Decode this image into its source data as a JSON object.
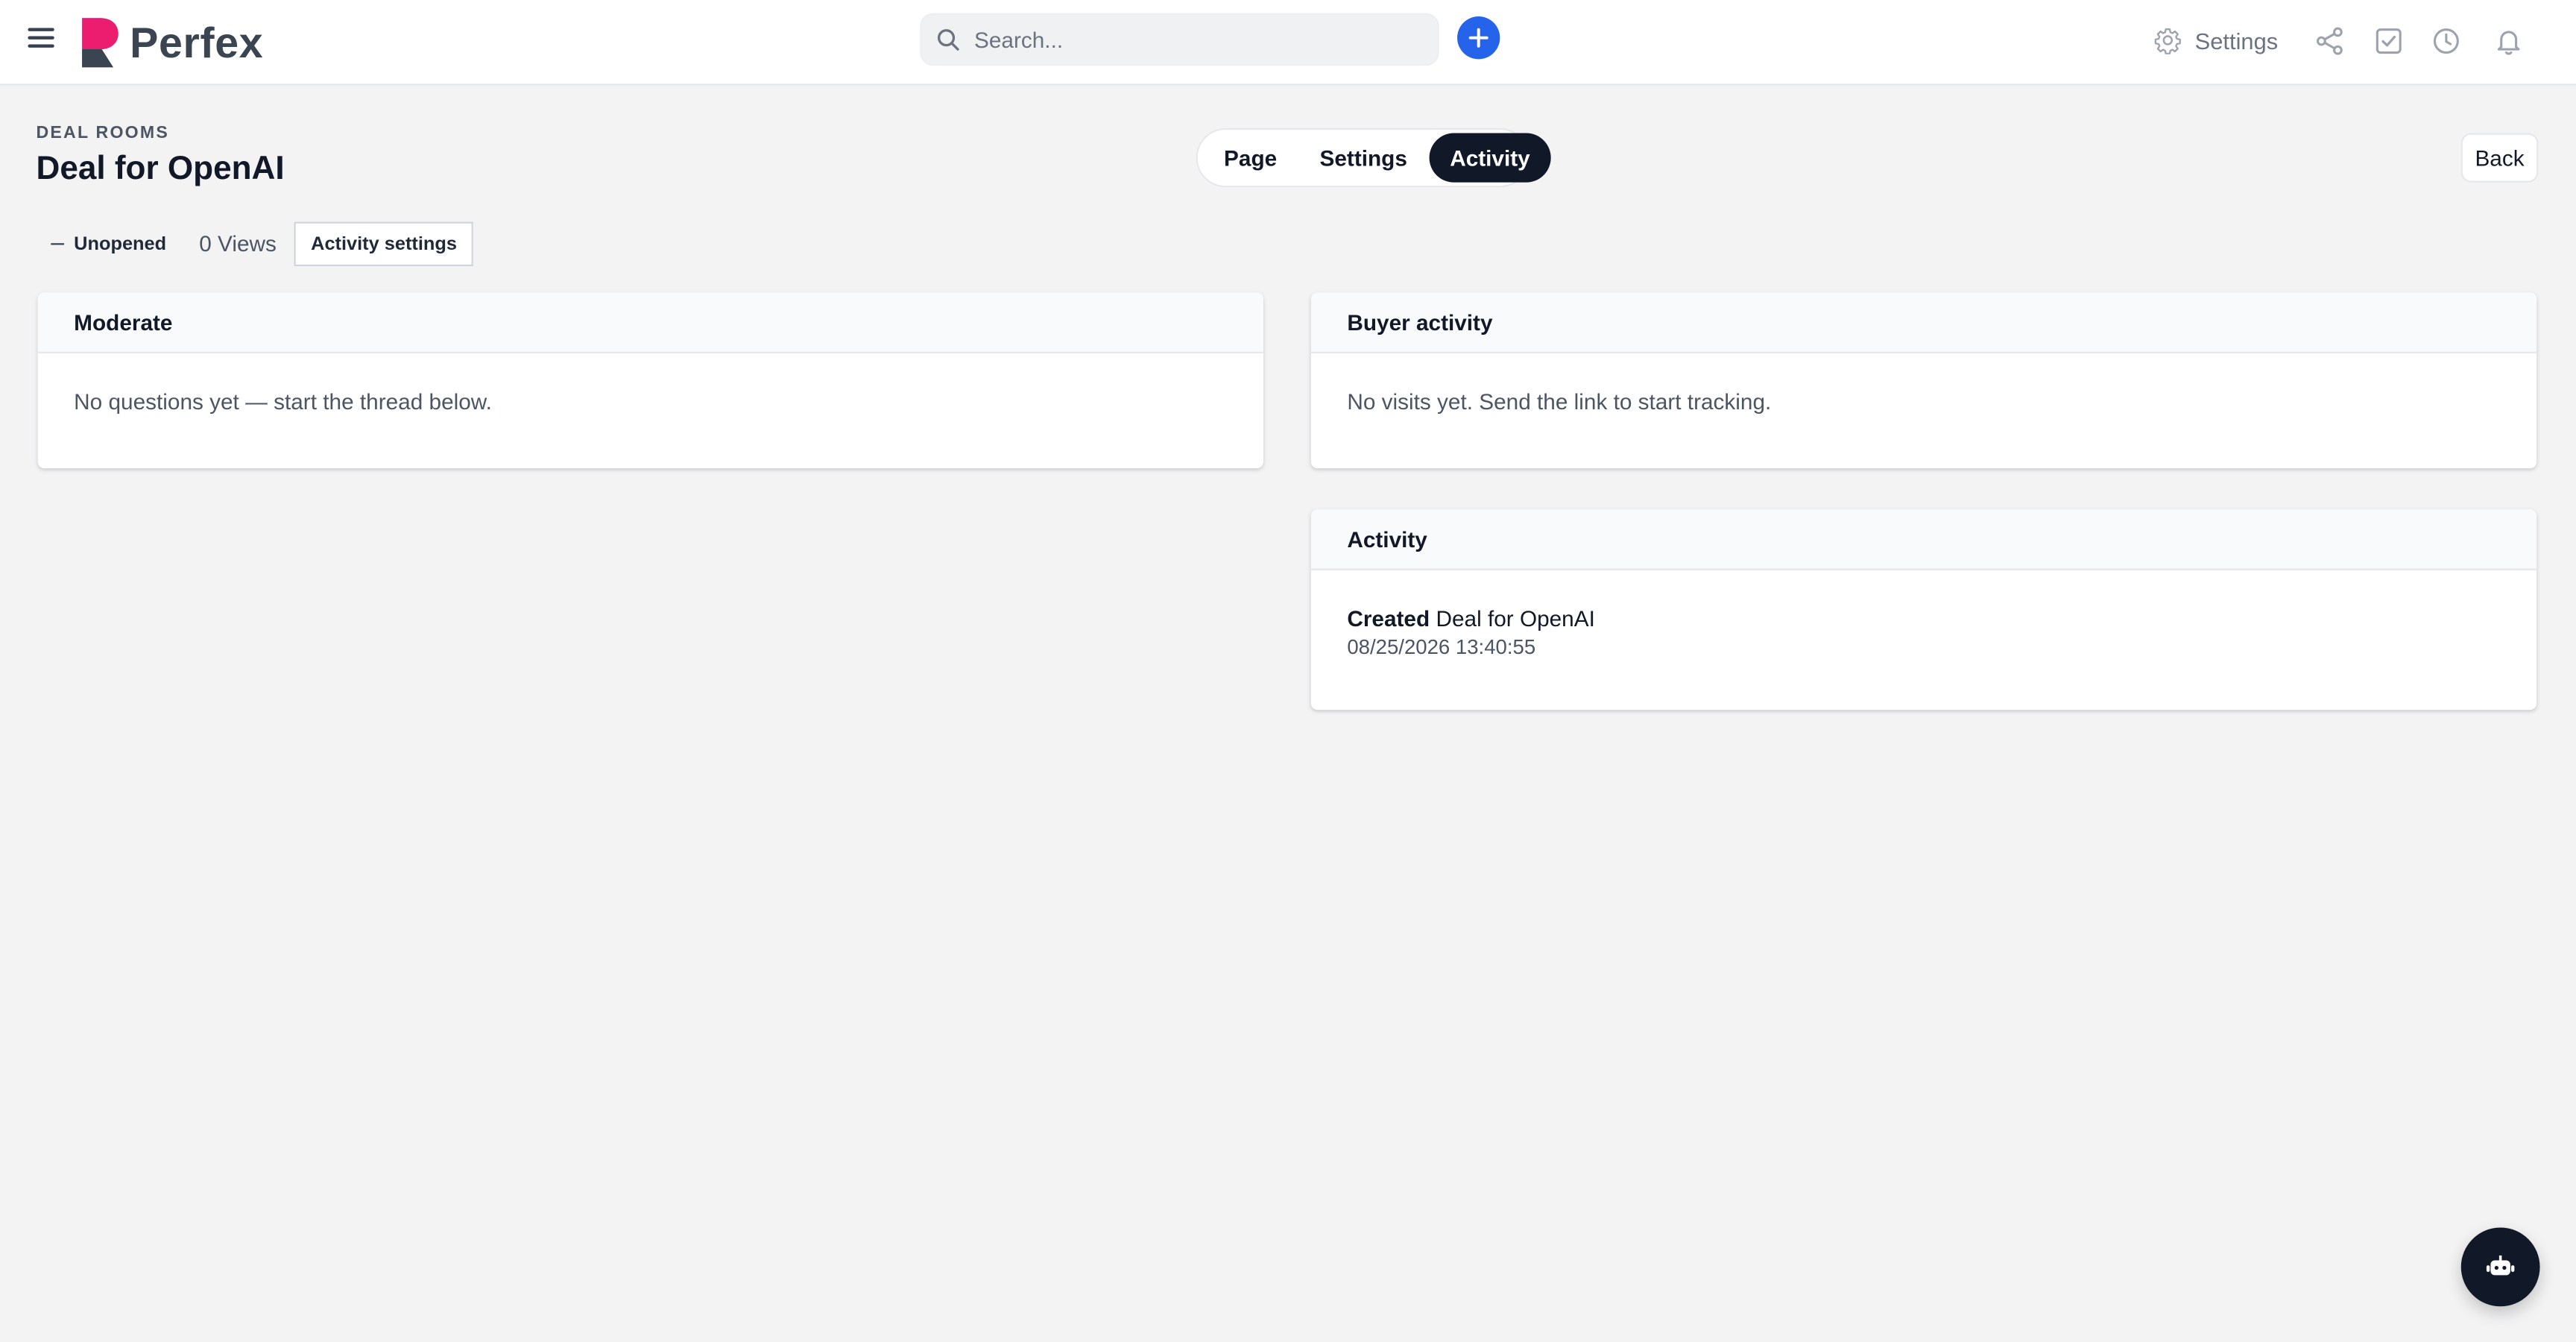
{
  "topbar": {
    "logo_text": "Perfex",
    "search_placeholder": "Search...",
    "settings_label": "Settings"
  },
  "header": {
    "eyebrow": "DEAL ROOMS",
    "title": "Deal for OpenAI",
    "tabs": [
      {
        "label": "Page",
        "active": false
      },
      {
        "label": "Settings",
        "active": false
      },
      {
        "label": "Activity",
        "active": true
      }
    ],
    "back_label": "Back"
  },
  "status": {
    "state": "Unopened",
    "views": "0 Views",
    "activity_settings_label": "Activity settings"
  },
  "cards": {
    "moderate": {
      "title": "Moderate",
      "body": "No questions yet — start the thread below."
    },
    "buyer_activity": {
      "title": "Buyer activity",
      "body": "No visits yet. Send the link to start tracking."
    },
    "activity": {
      "title": "Activity",
      "entry_verb": "Created",
      "entry_object": "Deal for OpenAI",
      "entry_time": "08/25/2026 13:40:55"
    }
  },
  "colors": {
    "accent": "#2563eb",
    "dark": "#111827",
    "background": "#f3f3f4"
  },
  "icons": [
    "menu-icon",
    "search-icon",
    "plus-icon",
    "gear-icon",
    "share-icon",
    "checkbox-icon",
    "clock-icon",
    "bell-icon",
    "bot-icon"
  ]
}
